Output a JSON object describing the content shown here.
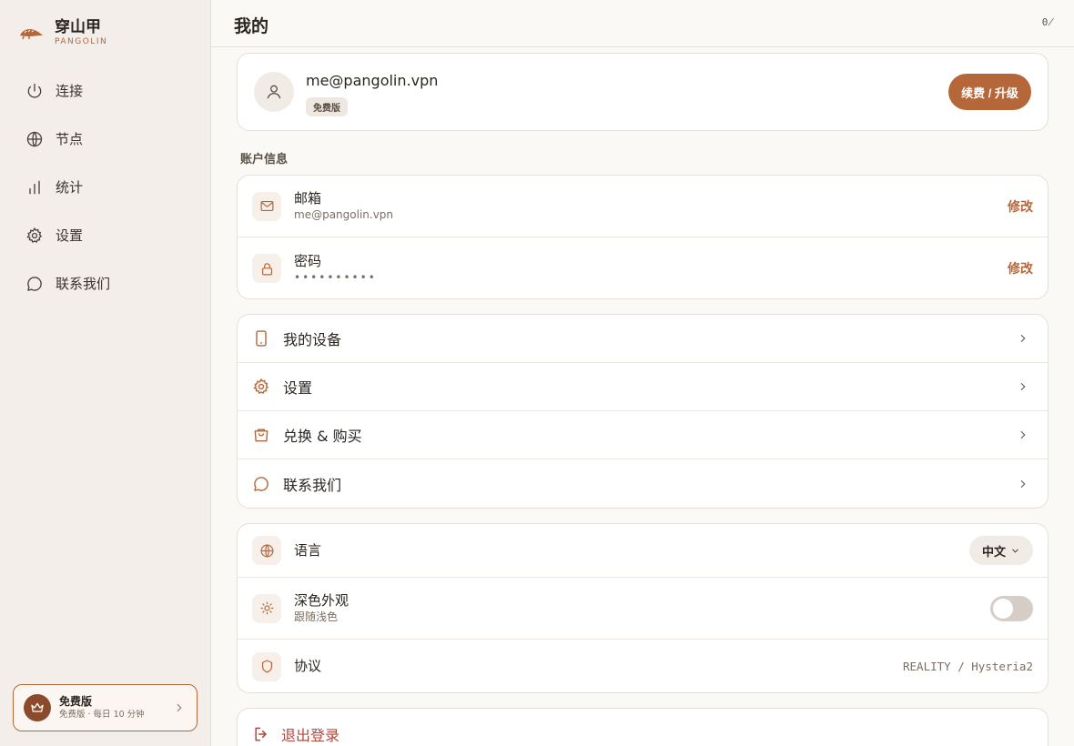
{
  "colors": {
    "accent": "#b5673a",
    "danger": "#b5473a",
    "sidebar_bg": "#f3eeea",
    "page_bg": "#fbf9f6"
  },
  "brand": {
    "name": "穿山甲",
    "sub": "PANGOLIN",
    "logo_icon": "pangolin-logo"
  },
  "sidebar": {
    "items": [
      {
        "label": "连接",
        "icon": "power-icon"
      },
      {
        "label": "节点",
        "icon": "globe-icon"
      },
      {
        "label": "统计",
        "icon": "bar-chart-icon"
      },
      {
        "label": "设置",
        "icon": "gear-icon"
      },
      {
        "label": "联系我们",
        "icon": "chat-icon"
      }
    ],
    "plan": {
      "title": "免费版",
      "sub": "免费版 · 每日 10 分钟",
      "icon": "crown-icon"
    }
  },
  "header": {
    "title": "我的",
    "glyph": "0̸"
  },
  "profile": {
    "email": "me@pangolin.vpn",
    "badge": "免费版",
    "upgrade_label": "续费 / 升级"
  },
  "account": {
    "section_label": "账户信息",
    "email": {
      "title": "邮箱",
      "value": "me@pangolin.vpn",
      "action": "修改",
      "icon": "mail-icon"
    },
    "password": {
      "title": "密码",
      "value": "••••••••••",
      "action": "修改",
      "icon": "lock-icon"
    }
  },
  "menu": {
    "devices": "我的设备",
    "settings": "设置",
    "redeem": "兑换 & 购买",
    "contact": "联系我们"
  },
  "prefs": {
    "language": {
      "title": "语言",
      "value": "中文"
    },
    "dark": {
      "title": "深色外观",
      "sub": "跟随浅色",
      "enabled": false
    },
    "protocol": {
      "title": "协议",
      "value": "REALITY / Hysteria2"
    }
  },
  "logout": {
    "label": "退出登录"
  }
}
